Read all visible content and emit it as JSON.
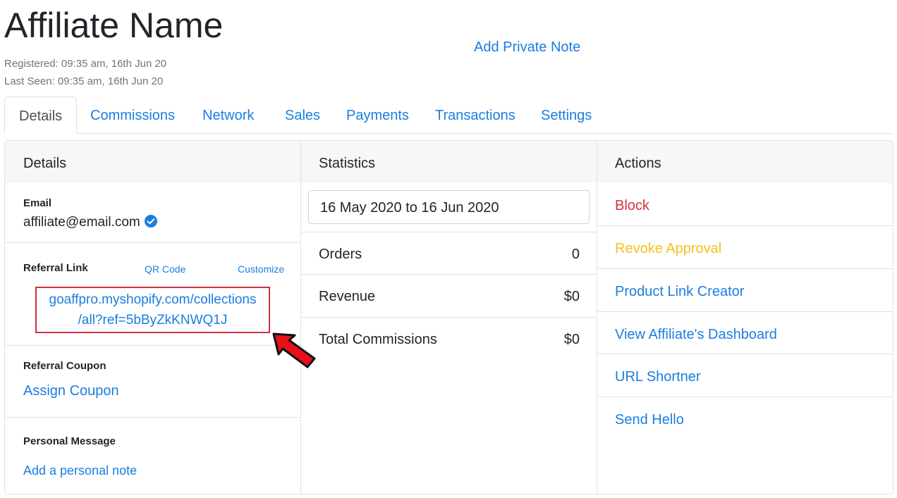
{
  "header": {
    "title": "Affiliate Name",
    "registered": "Registered: 09:35 am, 16th Jun 20",
    "last_seen": "Last Seen: 09:35 am, 16th Jun 20",
    "private_note_link": "Add Private Note"
  },
  "tabs": [
    {
      "label": "Details",
      "active": true
    },
    {
      "label": "Commissions"
    },
    {
      "label": "Network"
    },
    {
      "label": "Sales"
    },
    {
      "label": "Payments"
    },
    {
      "label": "Transactions"
    },
    {
      "label": "Settings"
    }
  ],
  "details": {
    "heading": "Details",
    "email_label": "Email",
    "email_value": "affiliate@email.com",
    "email_verified_icon": "check-circle-icon",
    "referral_link_label": "Referral Link",
    "qr_code_link": "QR Code",
    "customize_link": "Customize",
    "referral_link_line1": "goaffpro.myshopify.com/collections",
    "referral_link_line2": "/all?ref=5bByZkKNWQ1J",
    "referral_coupon_label": "Referral Coupon",
    "assign_coupon_link": "Assign Coupon",
    "personal_message_label": "Personal Message",
    "personal_note_link": "Add a personal note"
  },
  "statistics": {
    "heading": "Statistics",
    "date_range": "16 May 2020 to 16 Jun 2020",
    "rows": [
      {
        "label": "Orders",
        "value": "0"
      },
      {
        "label": "Revenue",
        "value": "$0"
      },
      {
        "label": "Total Commissions",
        "value": "$0"
      }
    ]
  },
  "actions": {
    "heading": "Actions",
    "items": [
      {
        "label": "Block",
        "style": "danger"
      },
      {
        "label": "Revoke Approval",
        "style": "warning"
      },
      {
        "label": "Product Link Creator"
      },
      {
        "label": "View Affiliate's Dashboard"
      },
      {
        "label": "URL Shortner"
      },
      {
        "label": "Send Hello"
      }
    ]
  },
  "colors": {
    "link": "#1a7ee0",
    "danger": "#d5313d",
    "warning": "#f5c020",
    "highlight_box": "#d03040",
    "arrow": "#e8101a"
  },
  "annotation_icon": "red-arrow-icon"
}
